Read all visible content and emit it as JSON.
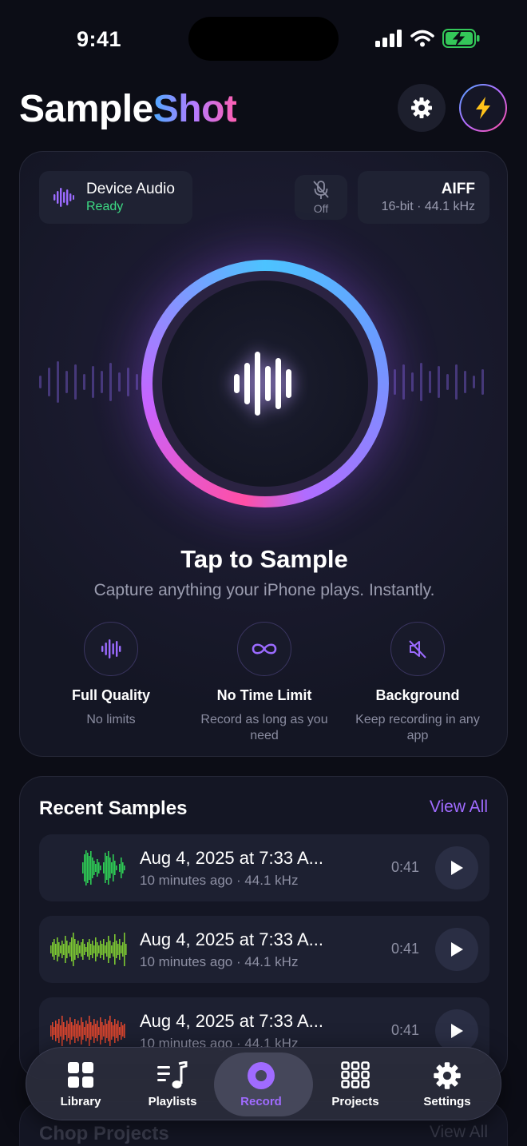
{
  "status_bar": {
    "time": "9:41"
  },
  "header": {
    "title_part1": "Sample",
    "title_part2": "Shot"
  },
  "record_card": {
    "source": {
      "title": "Device Audio",
      "status": "Ready"
    },
    "mic": {
      "label": "Off"
    },
    "format": {
      "title": "AIFF",
      "detail": "16-bit · 44.1 kHz"
    },
    "tap_title": "Tap to Sample",
    "tap_subtitle": "Capture anything your iPhone plays. Instantly.",
    "features": [
      {
        "icon": "waveform-icon",
        "title": "Full Quality",
        "subtitle": "No limits"
      },
      {
        "icon": "infinity-icon",
        "title": "No Time Limit",
        "subtitle": "Record as long as you need"
      },
      {
        "icon": "speaker-off-icon",
        "title": "Background",
        "subtitle": "Keep recording in any app"
      }
    ]
  },
  "recent_samples": {
    "title": "Recent Samples",
    "view_all": "View All",
    "items": [
      {
        "title": "Aug 4, 2025 at 7:33 A...",
        "subtitle": "10 minutes ago · 44.1 kHz",
        "duration": "0:41",
        "wave_color": "#2ecc55"
      },
      {
        "title": "Aug 4, 2025 at 7:33 A...",
        "subtitle": "10 minutes ago · 44.1 kHz",
        "duration": "0:41",
        "wave_color": "#7cc832"
      },
      {
        "title": "Aug 4, 2025 at 7:33 A...",
        "subtitle": "10 minutes ago · 44.1 kHz",
        "duration": "0:41",
        "wave_color": "#d9452e"
      }
    ]
  },
  "chop_projects": {
    "title": "Chop Projects",
    "view_all": "View All"
  },
  "tab_bar": {
    "tabs": [
      {
        "label": "Library",
        "icon": "grid-icon"
      },
      {
        "label": "Playlists",
        "icon": "music-list-icon"
      },
      {
        "label": "Record",
        "icon": "record-icon",
        "active": true
      },
      {
        "label": "Projects",
        "icon": "pads-grid-icon"
      },
      {
        "label": "Settings",
        "icon": "gear-icon"
      }
    ]
  },
  "colors": {
    "accent": "#a06bff",
    "ready": "#3ddc84",
    "background": "#0c0d16"
  }
}
